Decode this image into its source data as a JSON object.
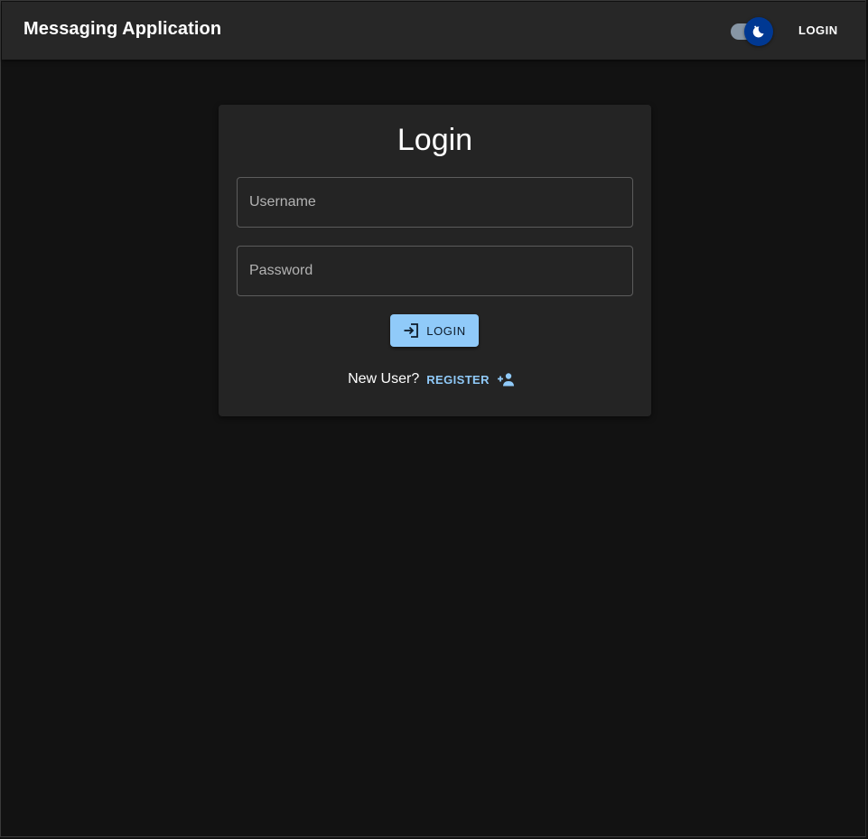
{
  "appbar": {
    "title": "Messaging Application",
    "theme_toggle_icon": "moon-icon",
    "login_label": "LOGIN"
  },
  "login_card": {
    "title": "Login",
    "username": {
      "placeholder": "Username",
      "value": ""
    },
    "password": {
      "placeholder": "Password",
      "value": ""
    },
    "login_button": {
      "label": "LOGIN",
      "icon": "login-icon"
    },
    "register": {
      "prompt": "New User?",
      "label": "REGISTER",
      "icon": "person-add-icon"
    }
  },
  "colors": {
    "background": "#121212",
    "appbar": "#272727",
    "card": "#242424",
    "primary": "#90caf9",
    "switch_thumb": "#003892",
    "switch_track": "#8796a5"
  }
}
